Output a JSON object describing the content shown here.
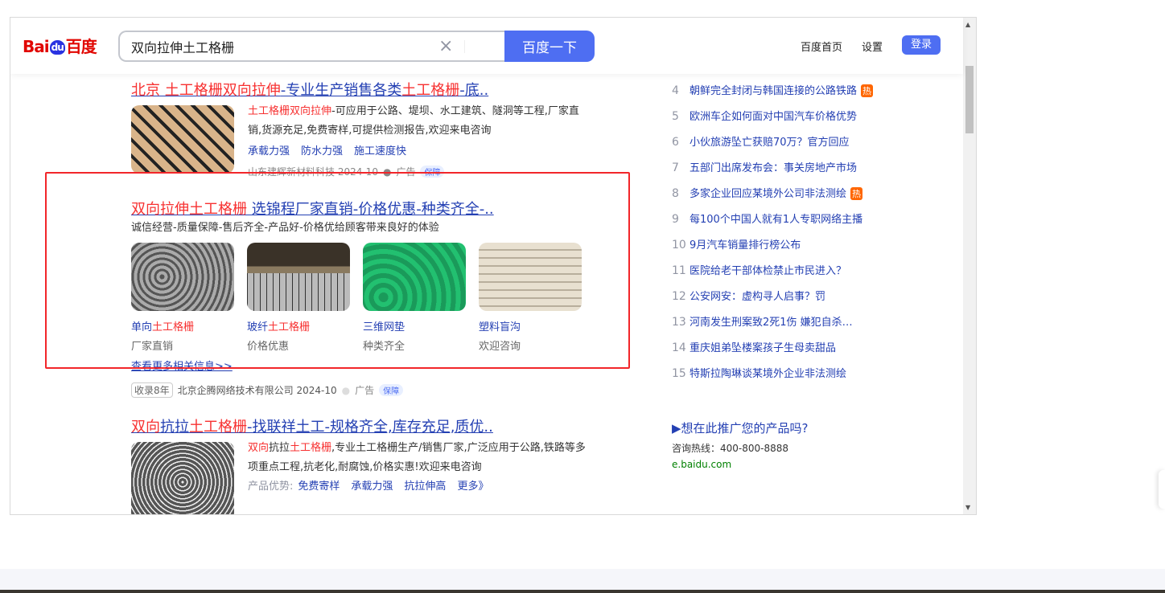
{
  "header": {
    "logo": "Baidu百度",
    "logo_parts": [
      "Bai",
      "du",
      "百度"
    ],
    "query": "双向拉伸土工格栅",
    "search_button": "百度一下",
    "nav": [
      "百度首页",
      "设置"
    ],
    "login": "登录"
  },
  "results": [
    {
      "title": [
        {
          "t": "北京 土工格栅双向拉伸",
          "hl": true
        },
        {
          "t": "-专业生产销售各类",
          "hl": false
        },
        {
          "t": "土工格栅",
          "hl": true
        },
        {
          "t": "-底..",
          "hl": false
        }
      ],
      "desc_hl": "土工格栅双向拉伸",
      "desc": "-可应用于公路、堤坝、水工建筑、隧洞等工程,厂家直销,货源充足,免费寄样,可提供检测报告,欢迎来电咨询",
      "links": [
        "承载力强",
        "防水力强",
        "施工速度快"
      ],
      "source": "山东建辉新材料科技 2024-10",
      "ad": "广告",
      "guarantee": "保障"
    },
    {
      "title": [
        {
          "t": "双向拉伸土工格栅",
          "hl": true
        },
        {
          "t": " 选锦程厂家直销-价格优惠-种类齐全-..",
          "hl": false
        }
      ],
      "desc": "诚信经营-质量保障-售后齐全-产品好-价格优给顾客带来良好的体验",
      "cards": [
        {
          "name": [
            {
              "t": "单向",
              "hl": false
            },
            {
              "t": "土工格栅",
              "hl": true
            }
          ],
          "sub": "厂家直销"
        },
        {
          "name": [
            {
              "t": "玻纤",
              "hl": false
            },
            {
              "t": "土工格栅",
              "hl": true
            }
          ],
          "sub": "价格优惠"
        },
        {
          "name": [
            {
              "t": "三维网垫",
              "hl": false
            }
          ],
          "sub": "种类齐全"
        },
        {
          "name": [
            {
              "t": "塑料盲沟",
              "hl": false
            }
          ],
          "sub": "欢迎咨询"
        }
      ],
      "more": "查看更多相关信息>>",
      "years": "收录8年",
      "source": "北京企腾网络技术有限公司 2024-10",
      "ad": "广告",
      "guarantee": "保障"
    },
    {
      "title": [
        {
          "t": "双向",
          "hl": true
        },
        {
          "t": "抗拉",
          "hl": false
        },
        {
          "t": "土工格栅",
          "hl": true
        },
        {
          "t": "-找联祥土工-规格齐全,库存充足,质优..",
          "hl": false
        }
      ],
      "desc_parts": [
        {
          "t": "双向",
          "hl": true
        },
        {
          "t": "抗拉",
          "hl": false
        },
        {
          "t": "土工格栅",
          "hl": true
        },
        {
          "t": ",专业土工格栅生产/销售厂家,广泛应用于公路,铁路等多项重点工程,抗老化,耐腐蚀,价格实惠!欢迎来电咨询",
          "hl": false
        }
      ],
      "links_label": "产品优势:",
      "links": [
        "免费寄样",
        "承载力强",
        "抗拉伸高",
        "更多》"
      ]
    }
  ],
  "hot": [
    {
      "n": "4",
      "t": "朝鲜完全封闭与韩国连接的公路铁路",
      "tag": "热"
    },
    {
      "n": "5",
      "t": "欧洲车企如何面对中国汽车价格优势"
    },
    {
      "n": "6",
      "t": "小伙旅游坠亡获赔70万？官方回应"
    },
    {
      "n": "7",
      "t": "五部门出席发布会：事关房地产市场"
    },
    {
      "n": "8",
      "t": "多家企业回应某境外公司非法测绘",
      "tag": "热"
    },
    {
      "n": "9",
      "t": "每100个中国人就有1人专职网络主播"
    },
    {
      "n": "10",
      "t": "9月汽车销量排行榜公布"
    },
    {
      "n": "11",
      "t": "医院给老干部体检禁止市民进入？"
    },
    {
      "n": "12",
      "t": "公安网安：虚构寻人启事？罚"
    },
    {
      "n": "13",
      "t": "河南发生刑案致2死1伤 嫌犯自杀…"
    },
    {
      "n": "14",
      "t": "重庆姐弟坠楼案孩子生母卖甜品"
    },
    {
      "n": "15",
      "t": "特斯拉陶琳谈某境外企业非法测绘"
    }
  ],
  "promo": {
    "title": "▶想在此推广您的产品吗?",
    "phone": "咨询热线：400-800-8888",
    "url": "e.baidu.com"
  },
  "colors": {
    "accent": "#4e6ef2",
    "link": "#2440b3",
    "highlight": "#f73131",
    "box": "#f2262a"
  }
}
